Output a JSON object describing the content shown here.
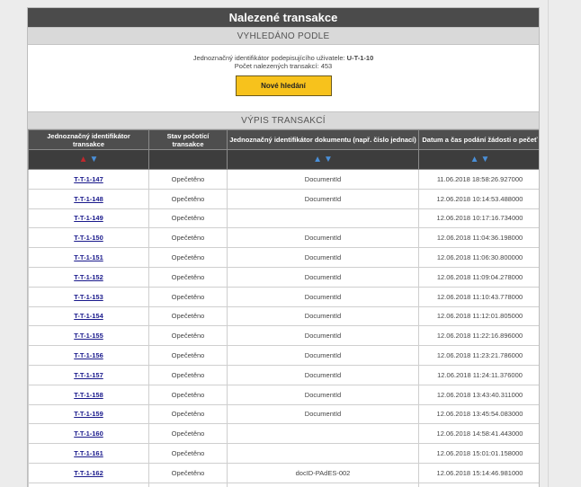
{
  "header": {
    "title": "Nalezené transakce"
  },
  "search_section": {
    "heading": "VYHLEDÁNO PODLE",
    "criterion_label": "Jednoznačný identifikátor podepisujícího uživatele:",
    "criterion_value": "U-T-1-10",
    "count_label": "Počet nalezených transakcí:",
    "count_value": "453",
    "new_search_label": "Nové hledání"
  },
  "list_section": {
    "heading": "VÝPIS TRANSAKCÍ"
  },
  "table": {
    "columns": [
      "Jednoznačný identifikátor transakce",
      "Stav počotící transakce",
      "Jednoznačný identifikátor dokumentu (např. číslo jednací)",
      "Datum a čas podání žádosti o pečeť"
    ],
    "rows": [
      {
        "id": "T-T-1-147",
        "status": "Opečetěno",
        "doc": "DocumentId",
        "date": "11.06.2018 18:58:26.927000"
      },
      {
        "id": "T-T-1-148",
        "status": "Opečetěno",
        "doc": "DocumentId",
        "date": "12.06.2018 10:14:53.488000"
      },
      {
        "id": "T-T-1-149",
        "status": "Opečetěno",
        "doc": "",
        "date": "12.06.2018 10:17:16.734000"
      },
      {
        "id": "T-T-1-150",
        "status": "Opečetěno",
        "doc": "DocumentId",
        "date": "12.06.2018 11:04:36.198000"
      },
      {
        "id": "T-T-1-151",
        "status": "Opečetěno",
        "doc": "DocumentId",
        "date": "12.06.2018 11:06:30.800000"
      },
      {
        "id": "T-T-1-152",
        "status": "Opečetěno",
        "doc": "DocumentId",
        "date": "12.06.2018 11:09:04.278000"
      },
      {
        "id": "T-T-1-153",
        "status": "Opečetěno",
        "doc": "DocumentId",
        "date": "12.06.2018 11:10:43.778000"
      },
      {
        "id": "T-T-1-154",
        "status": "Opečetěno",
        "doc": "DocumentId",
        "date": "12.06.2018 11:12:01.805000"
      },
      {
        "id": "T-T-1-155",
        "status": "Opečetěno",
        "doc": "DocumentId",
        "date": "12.06.2018 11:22:16.896000"
      },
      {
        "id": "T-T-1-156",
        "status": "Opečetěno",
        "doc": "DocumentId",
        "date": "12.06.2018 11:23:21.786000"
      },
      {
        "id": "T-T-1-157",
        "status": "Opečetěno",
        "doc": "DocumentId",
        "date": "12.06.2018 11:24:11.376000"
      },
      {
        "id": "T-T-1-158",
        "status": "Opečetěno",
        "doc": "DocumentId",
        "date": "12.06.2018 13:43:40.311000"
      },
      {
        "id": "T-T-1-159",
        "status": "Opečetěno",
        "doc": "DocumentId",
        "date": "12.06.2018 13:45:54.083000"
      },
      {
        "id": "T-T-1-160",
        "status": "Opečetěno",
        "doc": "",
        "date": "12.06.2018 14:58:41.443000"
      },
      {
        "id": "T-T-1-161",
        "status": "Opečetěno",
        "doc": "",
        "date": "12.06.2018 15:01:01.158000"
      },
      {
        "id": "T-T-1-162",
        "status": "Opečetěno",
        "doc": "docID-PAdES-002",
        "date": "12.06.2018 15:14:46.981000"
      },
      {
        "id": "",
        "status": "",
        "doc": "",
        "date": ""
      }
    ]
  },
  "icons": {
    "sort_up": "arrow-up-icon",
    "sort_down": "arrow-down-icon",
    "active_sort_color": "#c0282d",
    "sort_color": "#4a90d9"
  },
  "colors": {
    "title_bg": "#4b4b4b",
    "button_bg": "#f7c21c",
    "link": "#1a1a8c"
  }
}
